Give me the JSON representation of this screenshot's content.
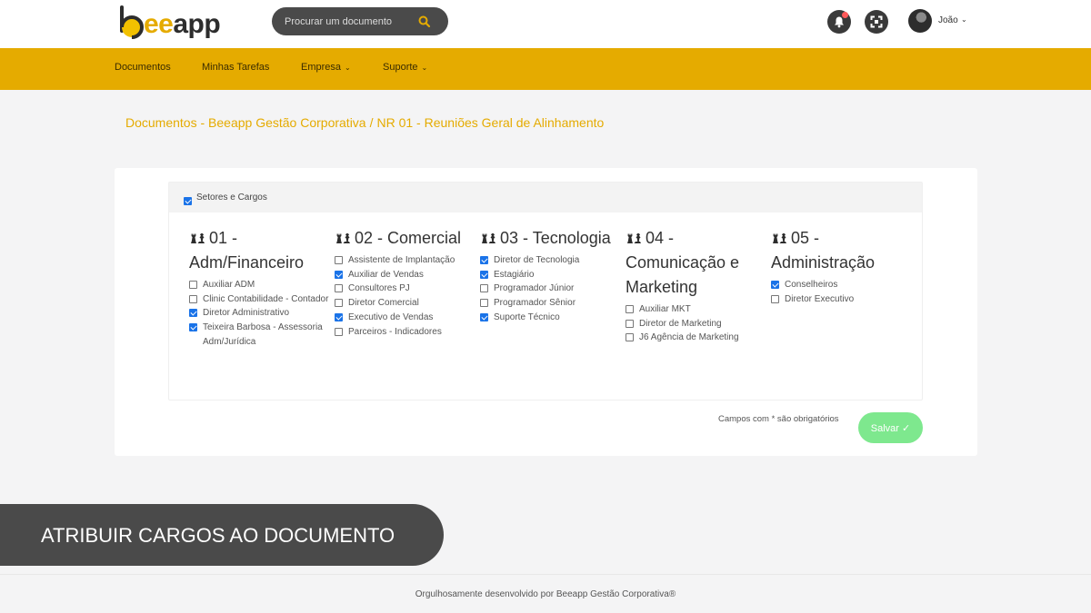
{
  "brand": {
    "logo_ee": "ee",
    "logo_app": "app",
    "accent_color": "#e5ab00"
  },
  "search": {
    "placeholder": "Procurar um documento",
    "icon": "search-icon"
  },
  "header": {
    "notification_icon": "bell-icon",
    "fullscreen_icon": "fullscreen-icon",
    "user_name": "João",
    "user_caret": "⌄"
  },
  "nav": {
    "items": [
      {
        "label": "Documentos"
      },
      {
        "label": "Minhas Tarefas"
      },
      {
        "label": "Empresa",
        "caret": "⌄"
      },
      {
        "label": "Suporte",
        "caret": "⌄"
      }
    ]
  },
  "breadcrumb": {
    "parent": "Documentos - Beeapp Gestão Corporativa",
    "separator": "/",
    "current": "NR 01 - Reuniões Geral de Alinhamento"
  },
  "form": {
    "master_label": "Setores e Cargos",
    "master_checked": true,
    "sectors": [
      {
        "title": "01 - Adm/Financeiro",
        "icon": "chess-icon",
        "roles": [
          {
            "label": "Auxiliar ADM",
            "checked": false
          },
          {
            "label": "Clinic Contabilidade - Contador",
            "checked": false
          },
          {
            "label": "Diretor Administrativo",
            "checked": true
          },
          {
            "label": "Teixeira Barbosa - Assessoria Adm/Jurídica",
            "checked": true
          }
        ]
      },
      {
        "title": "02 - Comercial",
        "icon": "chess-icon",
        "roles": [
          {
            "label": "Assistente de Implantação",
            "checked": false
          },
          {
            "label": "Auxiliar de Vendas",
            "checked": true
          },
          {
            "label": "Consultores PJ",
            "checked": false
          },
          {
            "label": "Diretor Comercial",
            "checked": false
          },
          {
            "label": "Executivo de Vendas",
            "checked": true
          },
          {
            "label": "Parceiros - Indicadores",
            "checked": false
          }
        ]
      },
      {
        "title": "03 - Tecnologia",
        "icon": "chess-icon",
        "roles": [
          {
            "label": "Diretor de Tecnologia",
            "checked": true
          },
          {
            "label": "Estagiário",
            "checked": true
          },
          {
            "label": "Programador Júnior",
            "checked": false
          },
          {
            "label": "Programador Sênior",
            "checked": false
          },
          {
            "label": "Suporte Técnico",
            "checked": true
          }
        ]
      },
      {
        "title": "04 - Comunicação e Marketing",
        "icon": "chess-icon",
        "roles": [
          {
            "label": "Auxiliar MKT",
            "checked": false
          },
          {
            "label": "Diretor de Marketing",
            "checked": false
          },
          {
            "label": "J6 Agência de Marketing",
            "checked": false
          }
        ]
      },
      {
        "title": "05 - Administração",
        "icon": "chess-icon",
        "roles": [
          {
            "label": "Conselheiros",
            "checked": true
          },
          {
            "label": "Diretor Executivo",
            "checked": false
          }
        ]
      }
    ],
    "required_note": "Campos com * são obrigatórios",
    "save_label": "Salvar ✓",
    "save_color": "#7ee88e",
    "checkbox_color": "#1a73e8"
  },
  "banner": {
    "text": "ATRIBUIR CARGOS AO DOCUMENTO"
  },
  "footer": {
    "text": "Orgulhosamente desenvolvido por Beeapp Gestão Corporativa®"
  }
}
